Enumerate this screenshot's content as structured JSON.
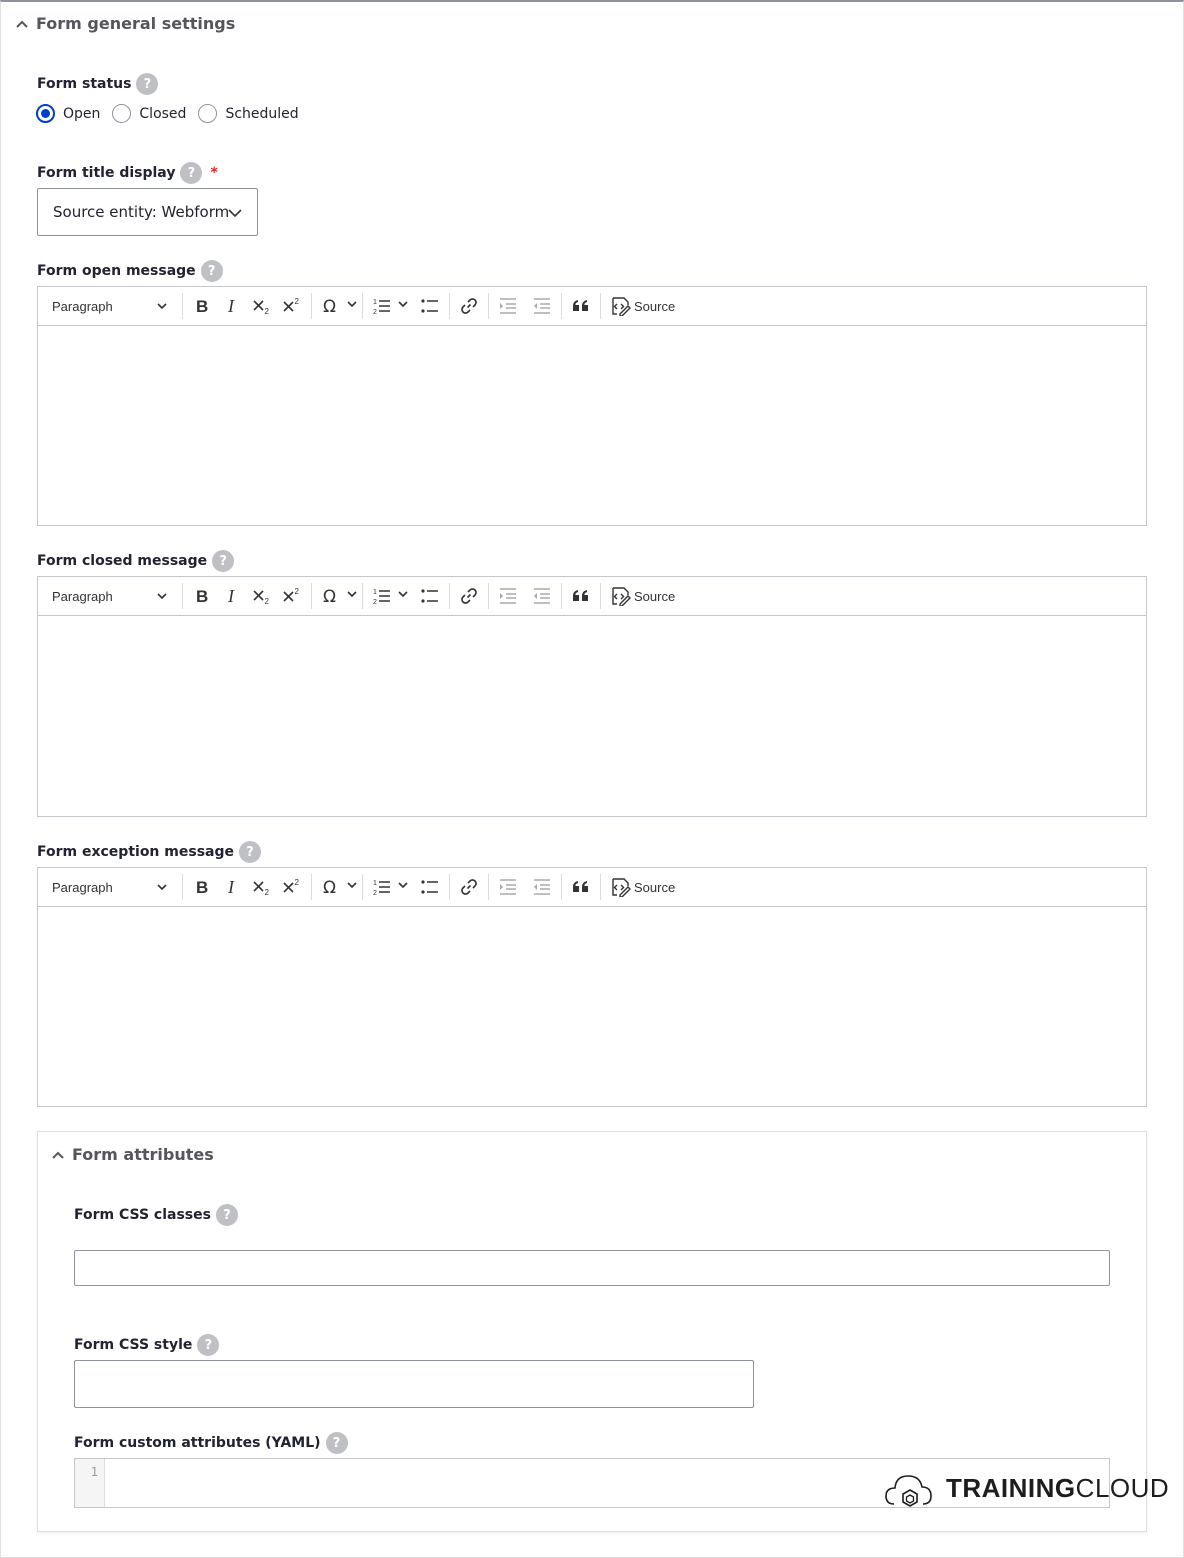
{
  "general": {
    "summary": "Form general settings",
    "status": {
      "label": "Form status",
      "help": "?",
      "options": [
        "Open",
        "Closed",
        "Scheduled"
      ],
      "selected": "Open"
    },
    "title_display": {
      "label": "Form title display",
      "help": "?",
      "required_mark": "*",
      "value": "Source entity: Webform"
    },
    "open_message": {
      "label": "Form open message",
      "help": "?"
    },
    "closed_message": {
      "label": "Form closed message",
      "help": "?"
    },
    "exception_message": {
      "label": "Form exception message",
      "help": "?"
    }
  },
  "editor_toolbar": {
    "heading_select": "Paragraph",
    "source_label": "Source",
    "icons": [
      "bold-icon",
      "italic-icon",
      "subscript-icon",
      "superscript-icon",
      "special-characters-icon",
      "numbered-list-icon",
      "bulleted-list-icon",
      "link-icon",
      "outdent-icon",
      "indent-icon",
      "blockquote-icon",
      "source-icon"
    ]
  },
  "attributes": {
    "summary": "Form attributes",
    "css_classes": {
      "label": "Form CSS classes",
      "help": "?",
      "value": ""
    },
    "css_style": {
      "label": "Form CSS style",
      "help": "?",
      "value": ""
    },
    "custom_attributes": {
      "label": "Form custom attributes (YAML)",
      "help": "?",
      "line_number": "1"
    }
  },
  "watermark": {
    "bold": "TRAINING",
    "regular": "CLOUD"
  }
}
